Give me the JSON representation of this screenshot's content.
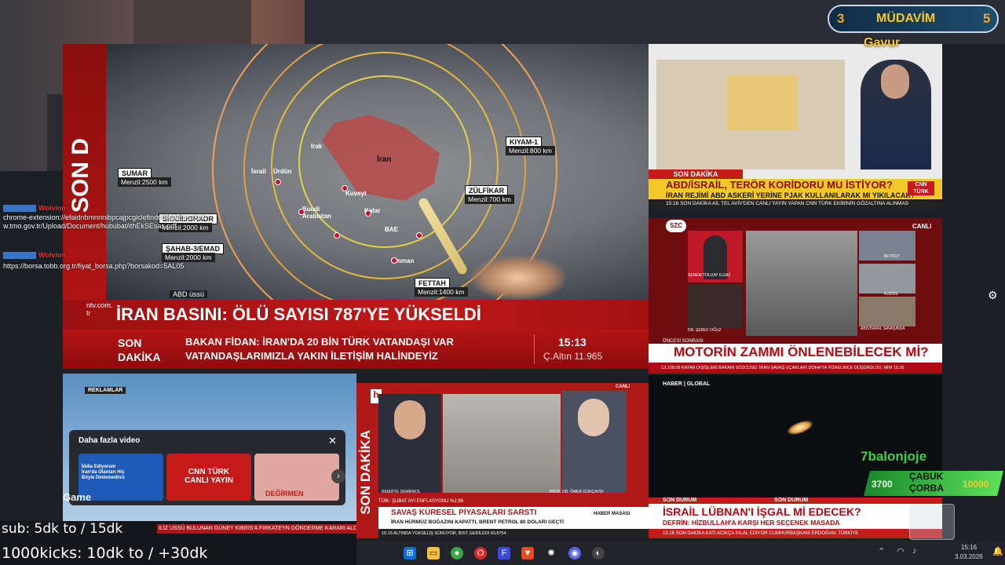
{
  "chat": [
    {
      "user": "Wolvion",
      "msg": "chrome-extension://efaidnbmnnnibpcajpcglclefindmkaj/https://www.tmo.gov.tr/Upload/Document/hububat/ithEkSEsas.pdf"
    },
    {
      "user": "Wolvion",
      "msg": "https://borsa.tobb.org.tr/fiyat_borsa.php?borsakod=5AL05"
    }
  ],
  "map": {
    "iran_label": "İran",
    "places": [
      "Irak",
      "Kuveyt",
      "Suudi Arabistan",
      "Katar",
      "BAE",
      "Umman",
      "İsrail",
      "Ürdün"
    ],
    "missiles": [
      {
        "name": "SUMAR",
        "range": "Menzil:2500 km"
      },
      {
        "name": "SİCCİL/GHADR",
        "range": "Menzil:2000 km"
      },
      {
        "name": "ŞAHAB-3/EMAD",
        "range": "Menzil:2000 km"
      },
      {
        "name": "KIYAM-1",
        "range": "Menzil:800 km"
      },
      {
        "name": "ZÜLFİKAR",
        "range": "Menzil:700 km"
      },
      {
        "name": "FETTAH",
        "range": "Menzil:1400 km"
      }
    ],
    "abd_ussu": "ABD üssü",
    "side_text": "SON D"
  },
  "ntv": {
    "logo": "ntv.com.tr",
    "headline": "İRAN BASINI: ÖLÜ SAYISI 787'YE YÜKSELDİ",
    "son_dakika": "SON\nDAKİKA",
    "ticker_line1": "BAKAN FİDAN: İRAN'DA 20 BİN TÜRK VATANDAŞI VAR",
    "ticker_line2": "VATANDAŞLARIMIZLA YAKIN İLETİŞİM HALİNDEYİZ",
    "time": "15:13",
    "gold": "Ç.Altın 11.965"
  },
  "cnn": {
    "son_dakika": "SON DAKİKA",
    "headline": "ABD/İSRAİL, TERÖR KORİDORU MU İSTİYOR?",
    "sub": "İRAN REJİMİ ABD ASKERİ YERİNE PJAK KULLANILARAK MI YIKILACAK?",
    "bottom": "15:16  SON DAKİKA  AİL TEL AVİV'DEN CANLI YAYIN YAPAN CNN TÜRK EKİBİNİN GÖZALTINA ALINMAS",
    "logo": "CNN TÜRK"
  },
  "szc": {
    "logo": "SZC",
    "canli": "CANLI",
    "person1": "SENEM TOLUAY ILGAZ",
    "person2": "DR. ŞEREF OĞUZ",
    "thumbs": [
      "BEYRUT",
      "KUDÜS",
      "ABD/İSRAİL SAVAŞINDA"
    ],
    "oncesi": "ÖNCESİ SONRASI",
    "headline": "MOTORİN ZAMMI ÖNLENEBİLECEK Mİ?",
    "ticker": "13.109,09  KATAR DIŞİŞLERİ BAKANI SÖZCÜSÜ: İRAN SAVAŞ UÇAKLARI DOHA'YA YÖNELİNCE DÜŞÜRÜLDÜ, MİM  15:16"
  },
  "yt": {
    "reklamlar": "REKLAMLAR",
    "more_videos": "Daha fazla video",
    "cards": [
      "İddia Ediyorum İran'da Olanları Hiç Böyle Dinlemediniz",
      "CNN TÜRK CANLI YAYIN",
      "DEĞİRMEN"
    ],
    "watermark": "ByNoGame"
  },
  "halk": {
    "son_dakika": "SON DAKİKA",
    "canli": "CANLI",
    "person1": "REMZİYE DEMİRKOL",
    "person2": "PROF. DR. ÖMER GÜNÇAVDI",
    "tuik": "TÜİK: ŞUBAT AYI ENFLASYONU %2,96",
    "headline": "SAVAŞ KÜRESEL PİYASALARI SARSTI",
    "sub": "İRAN HÜRMÜZ BOĞAZINI KAPATTI, BRENT PETROL 80 DOLARI GEÇTİ",
    "haber_masasi": "HABER MASASI",
    "ticker": "15:16  ALTINDA YÜKSELİŞ SÜRÜYOR, BIST GERİLEDİ  43.8754"
  },
  "haber": {
    "logo": "HABER | GLOBAL",
    "son_durum": "SON DURUM",
    "headline": "İSRAİL LÜBNAN'I İŞGAL Mİ EDECEK?",
    "sub": "DEFRİN: HİZBULLAH'A KARŞI HER SEÇENEK MASADA",
    "ticker": "15:16  SON DAKİKA  KATI ACIKÇA İHLAL EDİYOR  CUMHURBAŞKANI ERDOĞAN: TÜRKİYE"
  },
  "overlay": {
    "gavur": "Gavur",
    "balon": "7balonjoje",
    "cabuk": "ÇABUK\nÇORBA",
    "n3700": "3700",
    "n10000": "10000",
    "sub_line": "sub: 5dk to / 15dk",
    "kicks_line": "1000kicks: 10dk to / +30dk",
    "bottom_ticker": "ILİZ USSÜ BULUNAN GÜNEY KIBRIS'A FIRKATEYN GÖNDERME KARARI ALDI"
  },
  "score": {
    "left": "3",
    "label": "MÜDAVİM",
    "right": "5"
  },
  "clock": {
    "time": "15:16",
    "date": "3.03.2026"
  }
}
